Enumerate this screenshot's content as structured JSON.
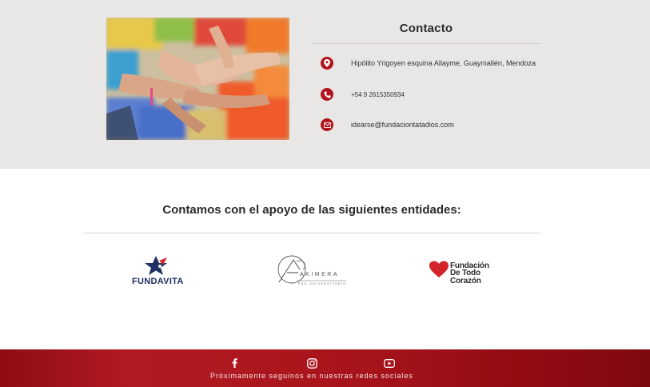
{
  "contact": {
    "title": "Contacto",
    "address": "Hipólito Yrigoyen esquina Allayme, Guaymallén, Mendoza",
    "phone": "+54 9 2615350934",
    "email": "idearse@fundaciontatadios.com",
    "icons": [
      "location-pin-icon",
      "phone-icon",
      "mail-icon"
    ]
  },
  "support": {
    "title": "Contamos con el apoyo de las siguientes entidades:",
    "logos": {
      "fundavita": "FUNDAVITA",
      "akimera": "AKIMERA",
      "akimera_sub": "PRE UNIVERSITARIO",
      "ftc_line1": "Fundación",
      "ftc_line2": "De Todo Corazón"
    }
  },
  "footer": {
    "text": "Próximamente seguinos en nuestras redes sociales",
    "social_icons": [
      "facebook-icon",
      "instagram-icon",
      "youtube-icon"
    ]
  },
  "colors": {
    "accent": "#b0141c",
    "section_bg": "#e9e7e6",
    "footer": "#a8141b"
  }
}
